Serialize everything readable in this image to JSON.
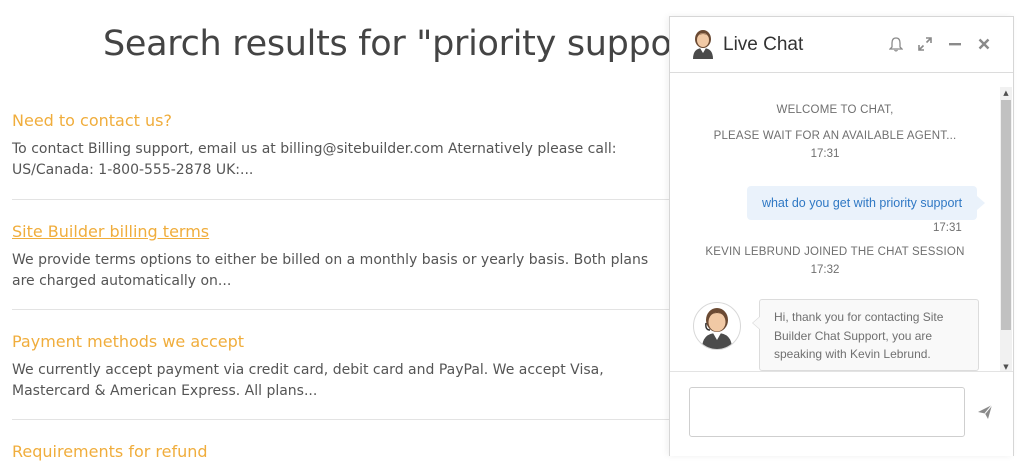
{
  "search": {
    "heading": "Search results for \"priority support\""
  },
  "results": [
    {
      "title": "Need to contact us?",
      "snippet": "To contact Billing support, email us at billing@sitebuilder.com Aternatively please call: US/Canada: 1-800-555-2878 UK:..."
    },
    {
      "title": "Site Builder billing terms",
      "snippet": "We provide terms options to either be billed on a monthly basis or yearly basis. Both plans are charged automatically on..."
    },
    {
      "title": "Payment methods we accept",
      "snippet": "We currently accept payment via credit card, debit card and PayPal. We accept Visa, Mastercard & American Express. All plans..."
    },
    {
      "title": "Requirements for refund"
    }
  ],
  "chat": {
    "title": "Live Chat",
    "header_icons": [
      "bell-icon",
      "expand-icon",
      "minimize-icon",
      "close-icon"
    ],
    "system_welcome": "WELCOME TO CHAT,",
    "system_wait": "PLEASE WAIT FOR AN AVAILABLE AGENT...",
    "system_wait_time": "17:31",
    "user_message": "what do you get with priority support",
    "user_message_time": "17:31",
    "agent_joined": "KEVIN LEBRUND JOINED THE CHAT SESSION",
    "agent_joined_time": "17:32",
    "agent_message": "Hi, thank you for contacting Site Builder Chat Support, you are speaking with Kevin Lebrund.",
    "input_value": "",
    "send_icon": "send-icon"
  },
  "colors": {
    "result_title": "#f0ad3c",
    "user_bubble_bg": "#eaf2fb",
    "user_bubble_text": "#2f78c4"
  }
}
